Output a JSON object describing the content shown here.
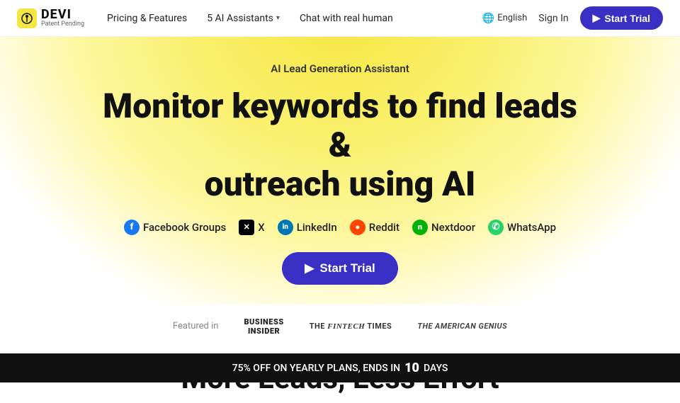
{
  "navbar": {
    "logo": "DEVI",
    "logo_sub": "Patent Pending",
    "nav_links": [
      {
        "label": "Pricing & Features",
        "has_chevron": false
      },
      {
        "label": "5 AI Assistants",
        "has_chevron": true
      },
      {
        "label": "Chat with real human",
        "has_chevron": false
      }
    ],
    "lang_label": "English",
    "sign_in_label": "Sign In",
    "start_trial_label": "Start Trial"
  },
  "hero": {
    "subtitle": "AI Lead Generation Assistant",
    "title_line1": "Monitor keywords to find leads &",
    "title_line2": "outreach using AI",
    "platforms": [
      {
        "name": "Facebook Groups",
        "icon": "F",
        "icon_class": "icon-fb"
      },
      {
        "name": "X",
        "icon": "✕",
        "icon_class": "icon-x"
      },
      {
        "name": "LinkedIn",
        "icon": "in",
        "icon_class": "icon-li"
      },
      {
        "name": "Reddit",
        "icon": "r",
        "icon_class": "icon-rd"
      },
      {
        "name": "Nextdoor",
        "icon": "n",
        "icon_class": "icon-nd"
      },
      {
        "name": "WhatsApp",
        "icon": "w",
        "icon_class": "icon-wa"
      }
    ],
    "cta_label": "Start Trial"
  },
  "featured": {
    "label": "Featured in",
    "logos": [
      {
        "text": "BUSINESS INSIDER",
        "class": "business-insider"
      },
      {
        "text": "THE FINTECH TIMES",
        "class": "fintech"
      },
      {
        "text": "The American Genius",
        "class": "american-genius"
      }
    ]
  },
  "more_leads": {
    "heading": "More Leads, Less Effort"
  },
  "banner": {
    "text_start": "75% OFF ON YEARLY PLANS, ENDS IN",
    "days": "10",
    "text_end": "DAYS"
  }
}
